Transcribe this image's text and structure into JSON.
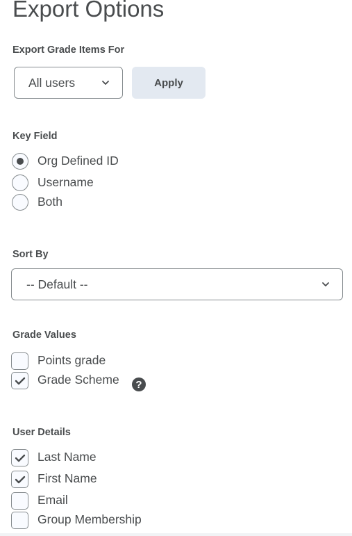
{
  "page": {
    "title": "Export Options"
  },
  "export_for": {
    "label": "Export Grade Items For",
    "selected": "All users",
    "apply_label": "Apply"
  },
  "key_field": {
    "label": "Key Field",
    "options": [
      {
        "label": "Org Defined ID",
        "selected": true
      },
      {
        "label": "Username",
        "selected": false
      },
      {
        "label": "Both",
        "selected": false
      }
    ]
  },
  "sort_by": {
    "label": "Sort By",
    "selected": "-- Default --"
  },
  "grade_values": {
    "label": "Grade Values",
    "options": [
      {
        "label": "Points grade",
        "checked": false
      },
      {
        "label": "Grade Scheme",
        "checked": true
      }
    ],
    "help_icon": "?"
  },
  "user_details": {
    "label": "User Details",
    "options": [
      {
        "label": "Last Name",
        "checked": true
      },
      {
        "label": "First Name",
        "checked": true
      },
      {
        "label": "Email",
        "checked": false
      },
      {
        "label": "Group Membership",
        "checked": false
      }
    ]
  }
}
